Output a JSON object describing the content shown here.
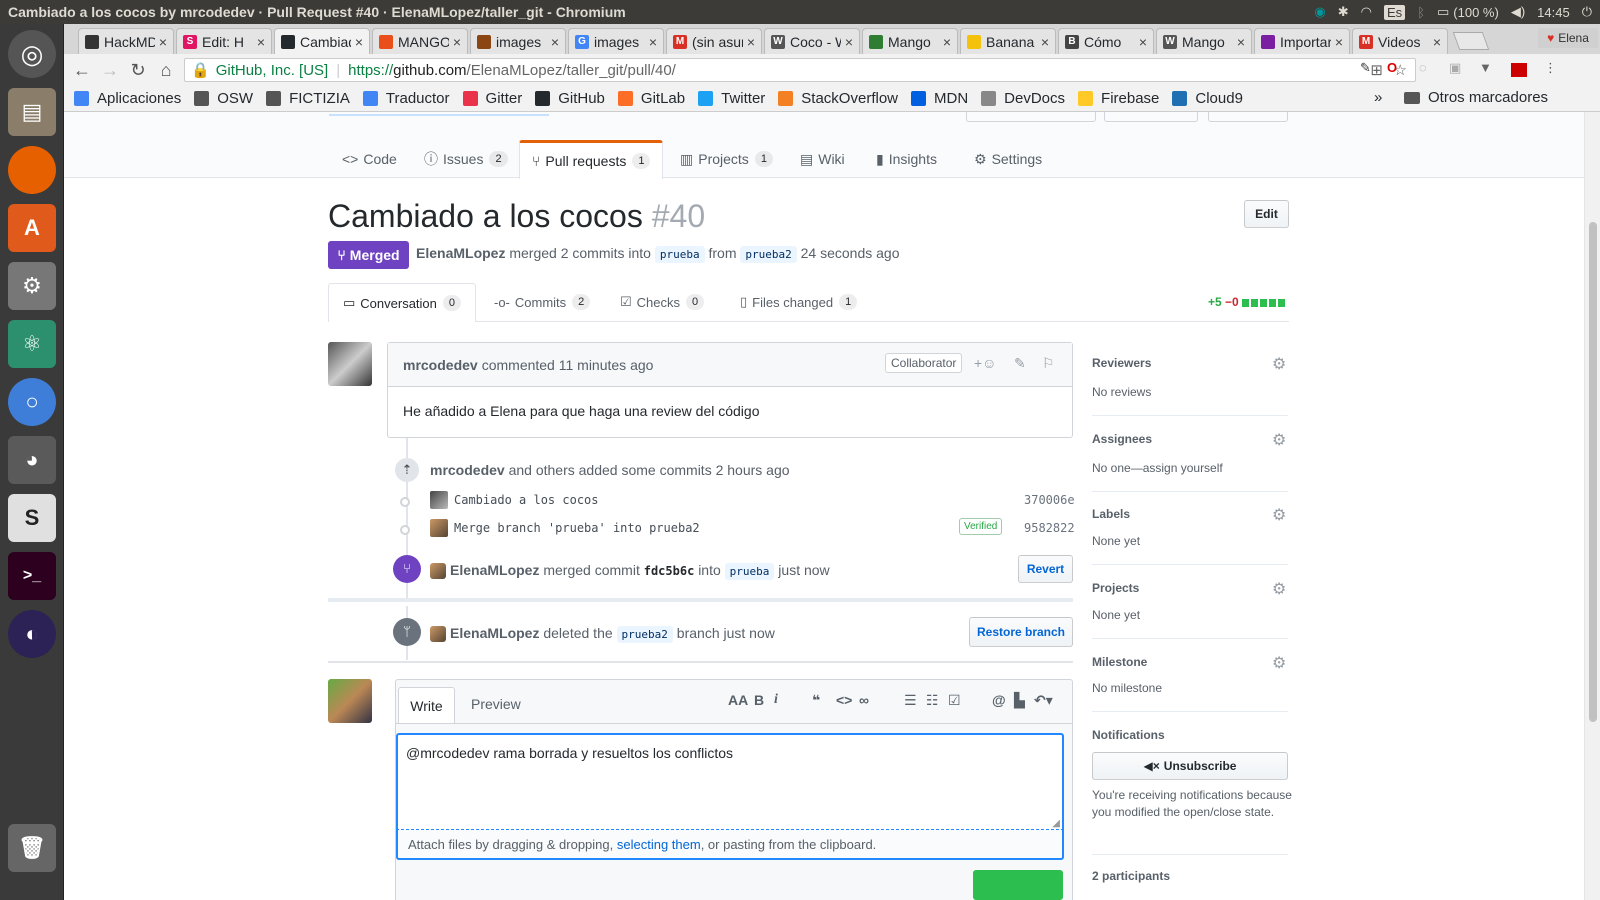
{
  "os": {
    "window_title": "Cambiado a los cocos by mrcodedev · Pull Request #40 · ElenaMLopez/taller_git - Chromium",
    "battery": "(100 %)",
    "time": "14:45",
    "kbd": "Es",
    "user": "Elena"
  },
  "tabs": [
    {
      "title": "HackMD",
      "color": "#333333",
      "glyph": ""
    },
    {
      "title": "Edit: H",
      "color": "#e01563",
      "glyph": "S"
    },
    {
      "title": "Cambiado a los cocos",
      "color": "#24292e",
      "glyph": ""
    },
    {
      "title": "MANGO",
      "color": "#e94e1b",
      "glyph": ""
    },
    {
      "title": "images",
      "color": "#8b4513",
      "glyph": ""
    },
    {
      "title": "images",
      "color": "#4285f4",
      "glyph": "G"
    },
    {
      "title": "(sin asunto)",
      "color": "#d93025",
      "glyph": "M"
    },
    {
      "title": "Coco - Wikipedia",
      "color": "#555555",
      "glyph": "W"
    },
    {
      "title": "Mango",
      "color": "#2e7d32",
      "glyph": ""
    },
    {
      "title": "Banana",
      "color": "#f4c20d",
      "glyph": ""
    },
    {
      "title": "Cómo",
      "color": "#444444",
      "glyph": "B"
    },
    {
      "title": "Mango",
      "color": "#555555",
      "glyph": "W"
    },
    {
      "title": "Importar",
      "color": "#7b1fa2",
      "glyph": ""
    },
    {
      "title": "Videos",
      "color": "#d93025",
      "glyph": "M"
    }
  ],
  "omnibox": {
    "cert": "GitHub, Inc. [US]",
    "scheme": "https://",
    "host": "github.com",
    "path": "/ElenaMLopez/taller_git/pull/40/"
  },
  "bookmarks": [
    {
      "label": "Aplicaciones",
      "color": "#4285f4"
    },
    {
      "label": "OSW",
      "color": "#555555"
    },
    {
      "label": "FICTIZIA",
      "color": "#555555"
    },
    {
      "label": "Traductor",
      "color": "#4285f4"
    },
    {
      "label": "Gitter",
      "color": "#e8334a"
    },
    {
      "label": "GitHub",
      "color": "#24292e"
    },
    {
      "label": "GitLab",
      "color": "#fc6d26"
    },
    {
      "label": "Twitter",
      "color": "#1da1f2"
    },
    {
      "label": "StackOverflow",
      "color": "#f48024"
    },
    {
      "label": "MDN",
      "color": "#0060df"
    },
    {
      "label": "DevDocs",
      "color": "#888888"
    },
    {
      "label": "Firebase",
      "color": "#ffca28"
    },
    {
      "label": "Cloud9",
      "color": "#1f6fb2"
    }
  ],
  "bookmarks_more": "»",
  "bookmarks_other": "Otros marcadores",
  "repo_nav": {
    "code": "Code",
    "issues": "Issues",
    "issues_count": "2",
    "pulls": "Pull requests",
    "pulls_count": "1",
    "projects": "Projects",
    "projects_count": "1",
    "wiki": "Wiki",
    "insights": "Insights",
    "settings": "Settings"
  },
  "pr": {
    "title": "Cambiado a los cocos",
    "number": "#40",
    "edit": "Edit",
    "state": "Merged",
    "author": "ElenaMLopez",
    "merged_text": "merged 2 commits into",
    "base": "prueba",
    "from_word": "from",
    "head": "prueba2",
    "time": "24 seconds ago"
  },
  "pr_tabs": {
    "conversation": "Conversation",
    "conversation_count": "0",
    "commits": "Commits",
    "commits_count": "2",
    "checks": "Checks",
    "checks_count": "0",
    "files": "Files changed",
    "files_count": "1",
    "additions": "+5",
    "deletions": "−0"
  },
  "comment": {
    "author": "mrcodedev",
    "meta": "commented 11 minutes ago",
    "badge": "Collaborator",
    "body": "He añadido a Elena para que haga una review del código"
  },
  "commits_event": {
    "author": "mrcodedev",
    "text": "and others added some commits 2 hours ago"
  },
  "commits": [
    {
      "message": "Cambiado a los cocos",
      "verified": "",
      "sha": "370006e"
    },
    {
      "message": "Merge branch 'prueba' into prueba2",
      "verified": "Verified",
      "sha": "9582822"
    }
  ],
  "merge_event": {
    "author": "ElenaMLopez",
    "text1": "merged commit",
    "sha": "fdc5b6c",
    "text2": "into",
    "branch": "prueba",
    "time": "just now",
    "button": "Revert"
  },
  "delete_event": {
    "author": "ElenaMLopez",
    "text1": "deleted the",
    "branch": "prueba2",
    "text2": "branch just now",
    "button": "Restore branch"
  },
  "editor": {
    "tab_write": "Write",
    "tab_preview": "Preview",
    "value": "@mrcodedev  rama borrada y resueltos los conflictos",
    "attach_1": "Attach files by dragging & dropping,",
    "attach_link": "selecting them",
    "attach_2": ", or pasting from the clipboard."
  },
  "sidebar": {
    "reviewers": "Reviewers",
    "reviewers_v": "No reviews",
    "assignees": "Assignees",
    "assignees_v": "No one—assign yourself",
    "labels": "Labels",
    "labels_v": "None yet",
    "projects": "Projects",
    "projects_v": "None yet",
    "milestone": "Milestone",
    "milestone_v": "No milestone",
    "notifications": "Notifications",
    "unsubscribe": "Unsubscribe",
    "notif_reason": "You're receiving notifications because you modified the open/close state.",
    "participants": "2 participants"
  },
  "colors": {
    "merged": "#6f42c1",
    "link": "#0366d6",
    "green": "#28a745",
    "red": "#cb2431",
    "orange": "#e36209"
  }
}
